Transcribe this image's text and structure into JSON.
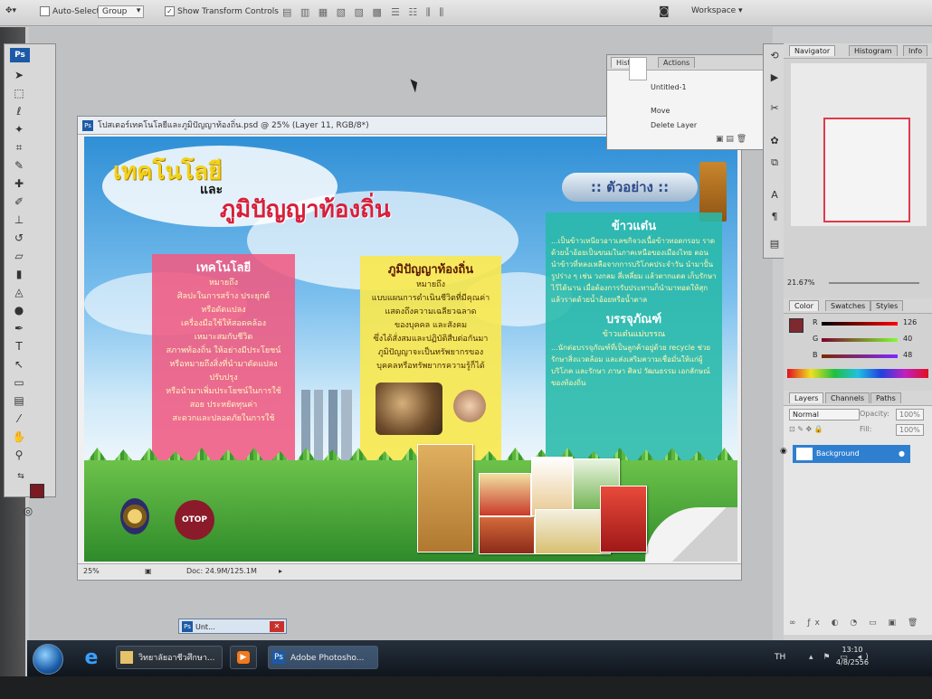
{
  "optbar": {
    "auto_select_label": "Auto-Select:",
    "auto_select_value": "Group",
    "show_transform_label": "Show Transform Controls",
    "workspace_label": "Workspace ▾"
  },
  "document": {
    "title": "โปสเตอร์เทคโนโลยีและภูมิปัญญาท้องถิ่น.psd @ 25% (Layer 11, RGB/8*)",
    "zoom": "25%",
    "doc_size": "Doc: 24.9M/125.1M"
  },
  "poster": {
    "title_tech": "เทคโนโลยี",
    "title_and": "และ",
    "title_wisdom": "ภูมิปัญญาท้องถิ่น",
    "example_pill": ":: ตัวอย่าง ::",
    "pink": {
      "heading": "เทคโนโลยี",
      "lines": [
        "หมายถึง",
        "ศิลปะในการสร้าง ประยุกต์",
        "หรือดัดแปลง",
        "เครื่องมือใช้ให้สอดคล้อง",
        "เหมาะสมกับชีวิต",
        "สภาพท้องถิ่น ให้อย่างมีประโยชน์",
        "หรือหมายถึงสิ่งที่นำมาดัดแปลง",
        "ปรับปรุง",
        "หรือนำมาเพิ่มประโยชน์ในการใช้",
        "สอย ประหยัดทุนค่า",
        "สะดวกและปลอดภัยในการใช้"
      ]
    },
    "yellow": {
      "heading": "ภูมิปัญญาท้องถิ่น",
      "lines": [
        "หมายถึง",
        "แบบแผนการดำเนินชีวิตที่มีคุณค่า",
        "แสดงถึงความเฉลียวฉลาด",
        "ของบุคคล และสังคม",
        "ซึ่งได้สั่งสมและปฏิบัติสืบต่อกันมา",
        "ภูมิปัญญาจะเป็นทรัพยากรของ",
        "บุคคลหรือทรัพยากรความรู้ก็ได้"
      ]
    },
    "teal": {
      "heading": "ข้าวแต๋น",
      "text": "...เป็นข้าวเหนียวอาวเลขกิจวงเนื้อข้าวทอดกรอบ ราดด้วยน้ำอ้อยเป็นขนมในภาคเหนือของเมืองไทย ตอนนำข้าวที่หลงเหลือจากการบริโภคประจำวัน นำมาปั้นรูปร่าง ๆ เช่น วงกลม สี่เหลี่ยม แล้วตากแดด เก็บรักษาไว้ได้นาน เมื่อต้องการรับประทานก็นำมาทอดให้สุกแล้วราดด้วยน้ำอ้อยหรือน้ำตาล",
      "heading2": "บรรจุภัณฑ์",
      "sub2": "ข้าวแต๋นแม่บรรณ",
      "text2": "...นักต่อบรรจุภัณฑ์ที่เป็นลูกค้าอยู่ด้วย recycle ช่วยรักษาสิ่งแวดล้อม และส่งเสริมความเชื่อมั่นให้แก่ผู้บริโภค และรักษา ภาษา ศิลป วัฒนธรรม เอกลักษณ์ของท้องถิ่น"
    },
    "otop_label": "OTOP"
  },
  "history": {
    "tab_history": "History",
    "tab_actions": "Actions",
    "snapshot": "Untitled-1",
    "items": [
      "Move",
      "Delete Layer"
    ]
  },
  "navigator": {
    "tab_navigator": "Navigator",
    "tab_histogram": "Histogram",
    "tab_info": "Info",
    "zoom": "21.67%"
  },
  "color_panel": {
    "tab_color": "Color",
    "tab_swatches": "Swatches",
    "tab_styles": "Styles",
    "r_label": "R",
    "g_label": "G",
    "b_label": "B",
    "r": "126",
    "g": "40",
    "b": "48",
    "fg_color": "#7e2830"
  },
  "layers": {
    "tab_layers": "Layers",
    "tab_channels": "Channels",
    "tab_paths": "Paths",
    "blend_mode": "Normal",
    "opacity_label": "Opacity:",
    "opacity": "100%",
    "fill_label": "Fill:",
    "fill": "100%",
    "layer_name": "Background"
  },
  "minimized": {
    "label": "Unt..."
  },
  "taskbar": {
    "folder_item": "วิทยาลัยอาชีวศึกษา...",
    "ps_item": "Adobe Photosho...",
    "lang": "TH",
    "time": "13:10",
    "date": "4/8/2556"
  }
}
